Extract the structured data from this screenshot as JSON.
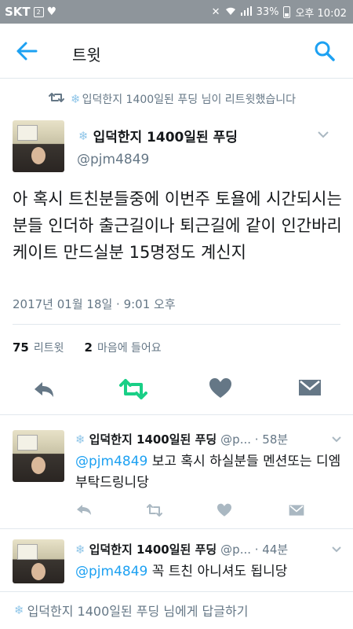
{
  "status_bar": {
    "carrier": "SKT",
    "sim_badge": "2",
    "battery": "33%",
    "time": "오후 10:02"
  },
  "app_bar": {
    "title": "트윗"
  },
  "retweet_context": "입덕한지 1400일된 푸딩 님이 리트윗했습니다",
  "main_tweet": {
    "name": "입덕한지 1400일된 푸딩",
    "handle": "@pjm4849",
    "text": "아 혹시 트친분들중에 이번주 토욜에 시간되시는 분들 인더하 출근길이나 퇴근길에 같이 인간바리케이트 만드실분 15명정도 계신지",
    "timestamp": "2017년 01월 18일 · 9:01 오후",
    "retweet_count": "75",
    "retweet_label": "리트윗",
    "like_count": "2",
    "like_label": "마음에 들어요"
  },
  "replies": [
    {
      "name": "입덕한지 1400일된 푸딩",
      "handle_time": "@p... · 58분",
      "mention": "@pjm4849",
      "text": " 보고 혹시 하실분들 멘션또는 디엠 부탁드링니당"
    },
    {
      "name": "입덕한지 1400일된 푸딩",
      "handle_time": "@p... · 44분",
      "mention": "@pjm4849",
      "text": " 꼭 트친 아니셔도 됩니당"
    }
  ],
  "reply_box": {
    "placeholder": "입덕한지 1400일된 푸딩 님에게 답글하기"
  },
  "colors": {
    "accent": "#1da1f2",
    "retweet_active": "#19cf86",
    "icon_gray": "#657786",
    "status_bar": "#8e959b"
  }
}
